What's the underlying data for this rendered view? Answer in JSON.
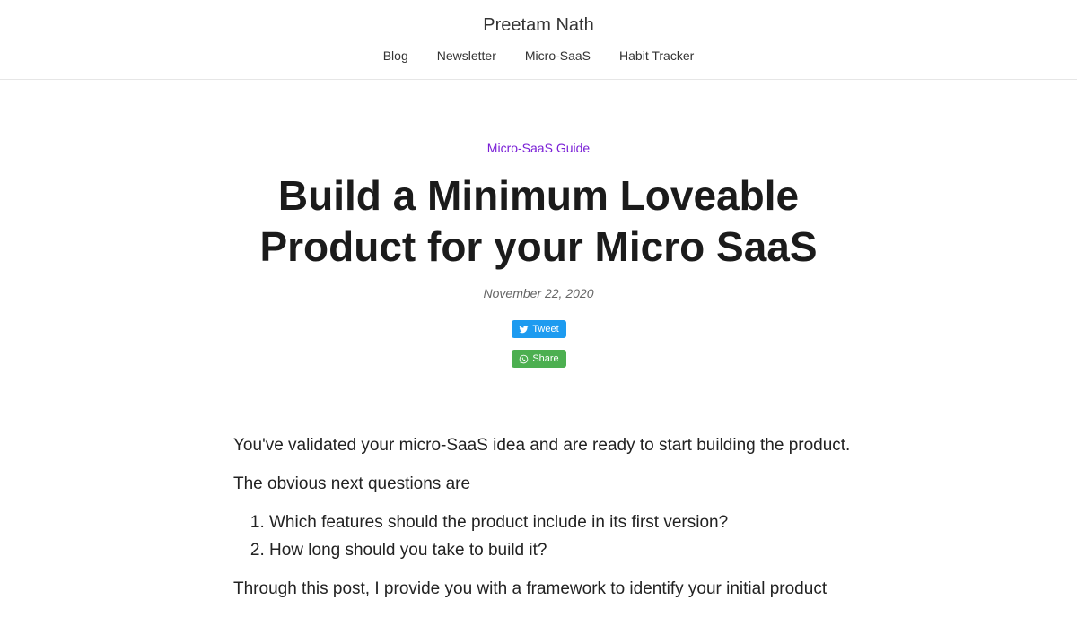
{
  "site": {
    "title": "Preetam Nath"
  },
  "nav": {
    "items": [
      "Blog",
      "Newsletter",
      "Micro-SaaS",
      "Habit Tracker"
    ]
  },
  "post": {
    "category": "Micro-SaaS Guide",
    "title": "Build a Minimum Loveable Product for your Micro SaaS",
    "date": "November 22, 2020",
    "share": {
      "tweet_label": "Tweet",
      "whatsapp_label": "Share"
    },
    "body": {
      "p1": "You've validated your micro-SaaS idea and are ready to start building the product.",
      "p2": "The obvious next questions are",
      "list": [
        "Which features should the product include in its first version?",
        "How long should you take to build it?"
      ],
      "p3": "Through this post, I provide you with a framework to identify your initial product"
    }
  },
  "colors": {
    "category": "#7a1fd6",
    "tweet_button": "#1d9bf0",
    "whatsapp_button": "#4caf50"
  },
  "icons": {
    "tweet": "twitter-bird-icon",
    "share": "whatsapp-icon"
  }
}
